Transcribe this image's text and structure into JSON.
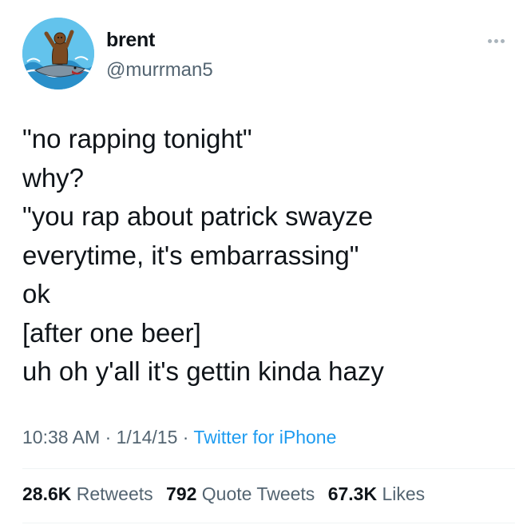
{
  "user": {
    "name": "brent",
    "handle": "@murrman5"
  },
  "tweet": {
    "lines": [
      "\"no rapping tonight\"",
      "why?",
      "\"you rap about patrick swayze",
      "everytime, it's embarrassing\"",
      "ok",
      "[after one beer]",
      "uh oh y'all it's gettin kinda hazy"
    ]
  },
  "meta": {
    "time": "10:38 AM",
    "date": "1/14/15",
    "separator": " · ",
    "source": "Twitter for iPhone"
  },
  "stats": {
    "retweets_count": "28.6K",
    "retweets_label": "Retweets",
    "quotes_count": "792",
    "quotes_label": "Quote Tweets",
    "likes_count": "67.3K",
    "likes_label": "Likes"
  },
  "icons": {
    "more": "more-options-icon"
  }
}
